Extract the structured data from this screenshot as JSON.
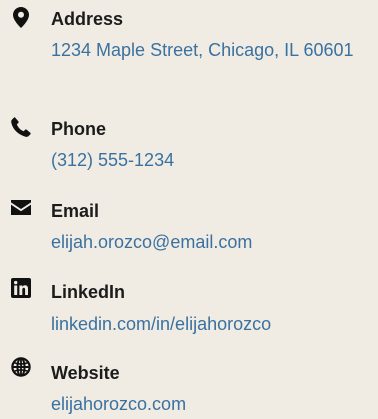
{
  "contacts": [
    {
      "icon": "map-marker-icon",
      "label": "Address",
      "value": "1234 Maple Street, Chicago, IL 60601"
    },
    {
      "icon": "phone-icon",
      "label": "Phone",
      "value": "(312) 555-1234"
    },
    {
      "icon": "envelope-icon",
      "label": "Email",
      "value": "elijah.orozco@email.com"
    },
    {
      "icon": "linkedin-icon",
      "label": "LinkedIn",
      "value": "linkedin.com/in/elijahorozco"
    },
    {
      "icon": "globe-icon",
      "label": "Website",
      "value": "elijahorozco.com"
    }
  ],
  "colors": {
    "background": "#f0ece4",
    "label": "#1c1c1c",
    "link": "#3a71a0",
    "icon": "#111111"
  }
}
